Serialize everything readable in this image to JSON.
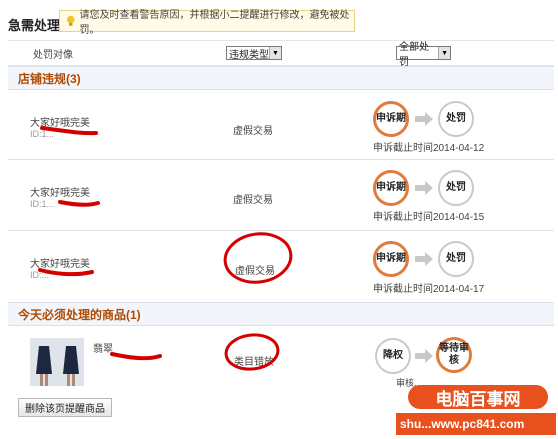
{
  "page": {
    "title": "急需处理",
    "notice": "请您及时查看警告原因，并根据小二提醒进行修改，避免被处罚。"
  },
  "filters": {
    "target_label": "处罚对像",
    "type_select": "违规类型",
    "status_select": "全部处罚"
  },
  "shop_section": {
    "heading": "店铺违规(3)",
    "rows": [
      {
        "shop": "大家好哦完美",
        "id": "ID:1...",
        "violation": "虚假交易",
        "step1": "申诉期",
        "step2": "处罚",
        "deadline": "申诉截止时间2014-04-12"
      },
      {
        "shop": "大家好哦完美",
        "id": "ID:1...",
        "violation": "虚假交易",
        "step1": "申诉期",
        "step2": "处罚",
        "deadline": "申诉截止时间2014-04-15"
      },
      {
        "shop": "大家好哦完美",
        "id": "ID:...",
        "violation": "虚假交易",
        "step1": "申诉期",
        "step2": "处罚",
        "deadline": "申诉截止时间2014-04-17"
      }
    ]
  },
  "goods_section": {
    "heading": "今天必须处理的商品(1)",
    "rows": [
      {
        "name": "翡翠",
        "violation": "类目错放",
        "step1": "降权",
        "step2": "等待审核",
        "deadline": "审核..."
      }
    ]
  },
  "footer": {
    "delete_button": "删除该页提醒商品"
  },
  "watermark": {
    "line1": "电脑百事网",
    "line2": "shu...www.pc841.com"
  },
  "colors": {
    "accent": "#e07b3c",
    "section_text": "#b04a00",
    "scribble": "#d40000"
  }
}
